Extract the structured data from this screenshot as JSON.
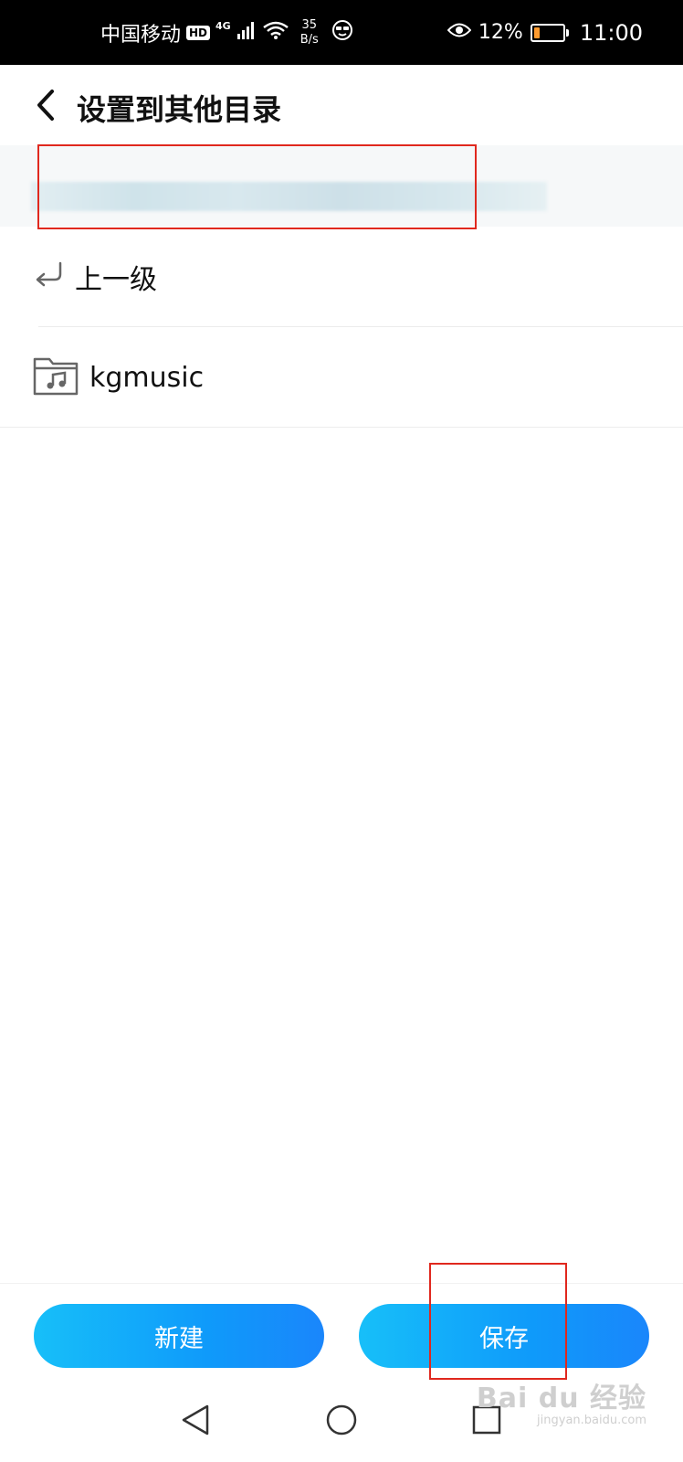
{
  "status_bar": {
    "carrier": "中国移动",
    "hd": "HD",
    "network": "4G",
    "speed_value": "35",
    "speed_unit": "B/s",
    "battery": "12%",
    "time": "11:00"
  },
  "header": {
    "title": "设置到其他目录"
  },
  "path_bar": {
    "path": ""
  },
  "list": [
    {
      "label": "上一级",
      "icon": "return-arrow-icon"
    },
    {
      "label": "kgmusic",
      "icon": "music-folder-icon"
    }
  ],
  "actions": {
    "new_label": "新建",
    "save_label": "保存"
  },
  "watermark": {
    "logo": "Bai du 经验",
    "sub": "jingyan.baidu.com"
  },
  "colors": {
    "button_gradient_start": "#17bff9",
    "button_gradient_end": "#1a86fb",
    "highlight_box": "#e0281e",
    "battery_low": "#ff9b2f"
  }
}
